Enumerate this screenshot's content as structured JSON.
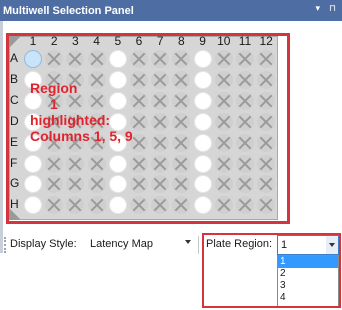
{
  "window": {
    "title": "Multiwell Selection Panel",
    "controls": [
      "▾",
      "⊓"
    ]
  },
  "plate": {
    "columns": [
      "1",
      "2",
      "3",
      "4",
      "5",
      "6",
      "7",
      "8",
      "9",
      "10",
      "11",
      "12"
    ],
    "rows": [
      "A",
      "B",
      "C",
      "D",
      "E",
      "F",
      "G",
      "H"
    ],
    "highlighted_columns": [
      1,
      5,
      9
    ],
    "selected_well": "A1",
    "annotation": {
      "line1": "Region",
      "line2": "1",
      "line3": "highlighted:",
      "line4": "Columns 1, 5, 9"
    }
  },
  "toolbar": {
    "display_style_label": "Display Style:",
    "display_style_value": "Latency Map",
    "plate_region_label": "Plate Region:",
    "plate_region_value": "1",
    "plate_region_options": [
      "1",
      "2",
      "3",
      "4"
    ],
    "plate_region_selected_index": 0
  },
  "colors": {
    "titlebar": "#4e6ea3",
    "annotation_red": "#e0242f",
    "frame_red": "#d3353f",
    "selected_option": "#3399ff",
    "well_selected": "#c9e3f9"
  }
}
